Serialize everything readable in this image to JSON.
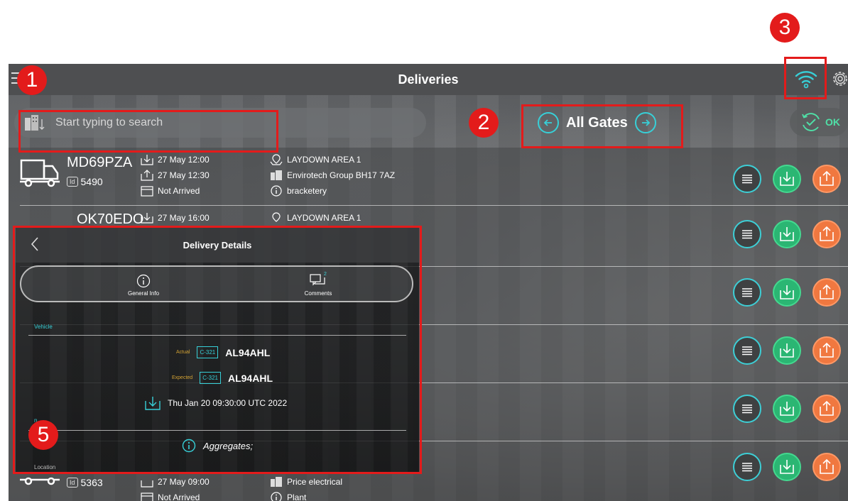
{
  "annotations": [
    "1",
    "2",
    "3",
    "5"
  ],
  "header": {
    "title": "Deliveries"
  },
  "search": {
    "placeholder": "Start typing to search"
  },
  "gates": {
    "label": "All Gates"
  },
  "ok_button": {
    "label": "OK"
  },
  "deliveries": [
    {
      "reg": "MD69PZA",
      "id": "5490",
      "arrive": "27 May 12:00",
      "depart": "27 May 12:30",
      "status": "Not Arrived",
      "area": "LAYDOWN AREA 1",
      "company": "Envirotech Group BH17 7AZ",
      "info": "bracketery"
    },
    {
      "reg": "OK70EDO",
      "id": "",
      "arrive": "27 May 16:00",
      "area": "LAYDOWN AREA 1"
    },
    {
      "reg": "",
      "id": "5363",
      "arrive": "27 May 09:00",
      "status": "Not Arrived",
      "company": "Price electrical",
      "info": "Plant"
    }
  ],
  "modal": {
    "title": "Delivery Details",
    "tabs": [
      {
        "label": "General Info"
      },
      {
        "label": "Comments",
        "badge": "2"
      }
    ],
    "vehicle_section": "Vehicle",
    "actual_label": "Actual",
    "expected_label": "Expected",
    "plate_code": "C-321",
    "actual_reg": "AL94AHL",
    "expected_reg": "AL94AHL",
    "datetime": "Thu Jan 20 09:30:00 UTC 2022",
    "location_section_partial": "n",
    "info_text": "Aggregates;",
    "location_section": "Location"
  },
  "colors": {
    "accent": "#37d0d8",
    "badge_red": "#e31b1b",
    "in_green": "#2bb673",
    "out_orange": "#f07840"
  }
}
